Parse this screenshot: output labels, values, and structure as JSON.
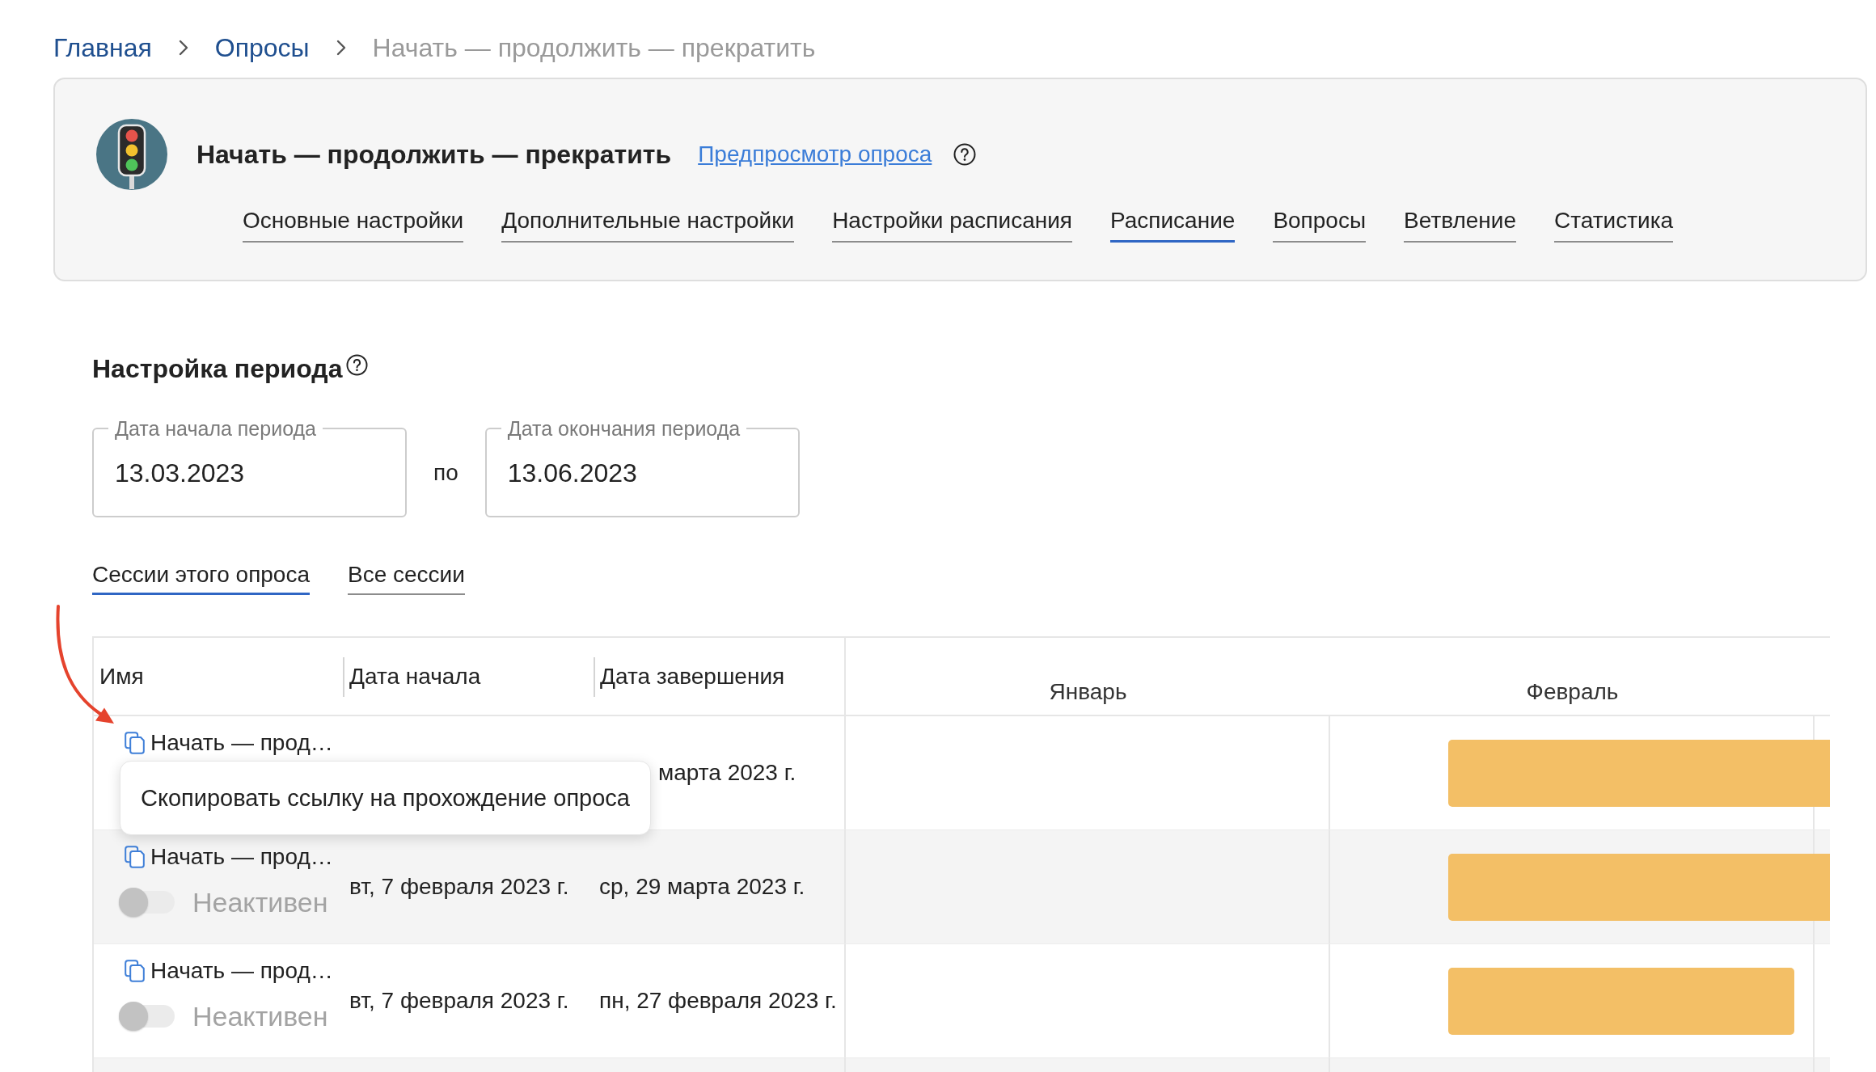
{
  "breadcrumbs": [
    {
      "label": "Главная",
      "kind": "link"
    },
    {
      "label": "Опросы",
      "kind": "link"
    },
    {
      "label": "Начать — продолжить — прекратить",
      "kind": "current"
    }
  ],
  "survey": {
    "title": "Начать — продолжить — прекратить",
    "preview_link": "Предпросмотр опроса"
  },
  "tabs": [
    {
      "label": "Основные настройки",
      "selected": false
    },
    {
      "label": "Дополнительные настройки",
      "selected": false
    },
    {
      "label": "Настройки расписания",
      "selected": false
    },
    {
      "label": "Расписание",
      "selected": true
    },
    {
      "label": "Вопросы",
      "selected": false
    },
    {
      "label": "Ветвление",
      "selected": false
    },
    {
      "label": "Статистика",
      "selected": false
    }
  ],
  "period": {
    "title": "Настройка периода",
    "start": {
      "label": "Дата начала периода",
      "value": "13.03.2023"
    },
    "separator": "по",
    "end": {
      "label": "Дата окончания периода",
      "value": "13.06.2023"
    }
  },
  "session_tabs": [
    {
      "label": "Сессии этого опроса",
      "selected": true
    },
    {
      "label": "Все сессии",
      "selected": false
    }
  ],
  "table": {
    "columns": [
      "Имя",
      "Дата начала",
      "Дата завершения"
    ],
    "months": [
      "Январь",
      "Февраль"
    ],
    "rows": [
      {
        "name": "Начать — прод…",
        "end_date": "марта 2023 г.",
        "tooltip": "Скопировать ссылку на прохождение опроса"
      },
      {
        "name": "Начать — прод…",
        "active": false,
        "status": "Неактивен",
        "start_date": "вт, 7 февраля 2023 г.",
        "end_date": "ср, 29 марта 2023 г."
      },
      {
        "name": "Начать — прод…",
        "active": false,
        "status": "Неактивен",
        "start_date": "вт, 7 февраля 2023 г.",
        "end_date": "пн, 27 февраля 2023 г."
      }
    ]
  }
}
